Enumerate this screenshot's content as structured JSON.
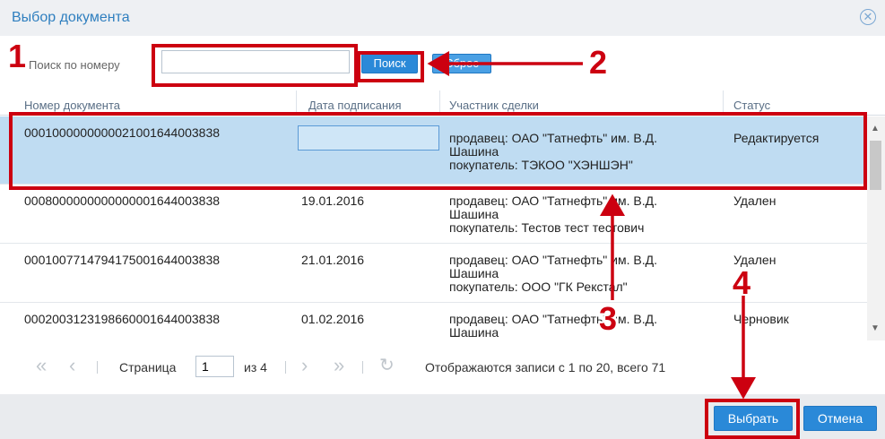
{
  "dialog": {
    "title": "Выбор документа",
    "close_icon": "close-circle-icon"
  },
  "search": {
    "label": "Поиск по номеру",
    "value": "",
    "search_button": "Поиск",
    "reset_button": "Сброс"
  },
  "columns": [
    "Номер документа",
    "Дата подписания",
    "Участник сделки",
    "Статус"
  ],
  "rows": [
    {
      "number": "0001000000000021001644003838",
      "date": "",
      "party_line1": "продавец: ОАО \"Татнефть\" им. В.Д.",
      "party_line2": "Шашина",
      "party_line3": "покупатель: ТЭКОО \"ХЭНШЭН\"",
      "status": "Редактируется",
      "selected": true
    },
    {
      "number": "0008000000000000001644003838",
      "date": "19.01.2016",
      "party_line1": "продавец: ОАО \"Татнефть\" им. В.Д.",
      "party_line2": "Шашина",
      "party_line3": "покупатель: Тестов тест тестович",
      "status": "Удален",
      "selected": false
    },
    {
      "number": "0001007714794175001644003838",
      "date": "21.01.2016",
      "party_line1": "продавец: ОАО \"Татнефть\" им. В.Д.",
      "party_line2": "Шашина",
      "party_line3": "покупатель: ООО \"ГК Рекстал\"",
      "status": "Удален",
      "selected": false
    },
    {
      "number": "0002003123198660001644003838",
      "date": "01.02.2016",
      "party_line1": "продавец: ОАО \"Татнефть\" им. В.Д.",
      "party_line2": "Шашина",
      "party_line3": "",
      "status": "Черновик",
      "selected": false
    }
  ],
  "pager": {
    "page_label": "Страница",
    "page_value": "1",
    "of_label": "из 4",
    "summary": "Отображаются записи с 1 по 20, всего 71"
  },
  "footer": {
    "select_button": "Выбрать",
    "cancel_button": "Отмена"
  },
  "annotations": {
    "step1": "1",
    "step2": "2",
    "step3": "3",
    "step4": "4",
    "color": "#cc0010"
  },
  "colors": {
    "accent": "#2a89d8",
    "selected_row": "#bfdcf2",
    "title": "#2f7fbf"
  }
}
